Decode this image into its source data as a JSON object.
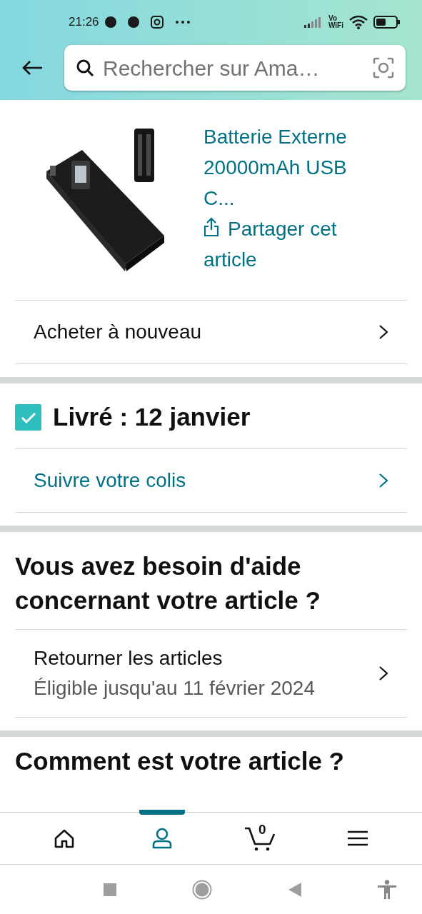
{
  "status_bar": {
    "time": "21:26",
    "network_label": "Vo\nWiFi"
  },
  "search": {
    "placeholder": "Rechercher sur Ama…"
  },
  "product": {
    "kind": "picture",
    "title": "Batterie Externe 20000mAh USB C...",
    "share": "Partager cet article"
  },
  "buy_again": {
    "label": "Acheter à nouveau"
  },
  "delivery": {
    "checked": true,
    "status": "Livré : 12 janvier",
    "track": "Suivre votre colis"
  },
  "help": {
    "heading": "Vous avez besoin d'aide concernant votre article ?",
    "items": [
      {
        "title": "Retourner les articles",
        "subtitle": "Éligible jusqu'au 11 février 2024"
      }
    ]
  },
  "review": {
    "heading": "Comment est votre article ?"
  },
  "bottom_nav": [
    {
      "kind": "home",
      "selected": false
    },
    {
      "kind": "account",
      "selected": true
    },
    {
      "kind": "cart",
      "selected": false,
      "count": "0"
    },
    {
      "kind": "menu",
      "selected": false
    }
  ]
}
